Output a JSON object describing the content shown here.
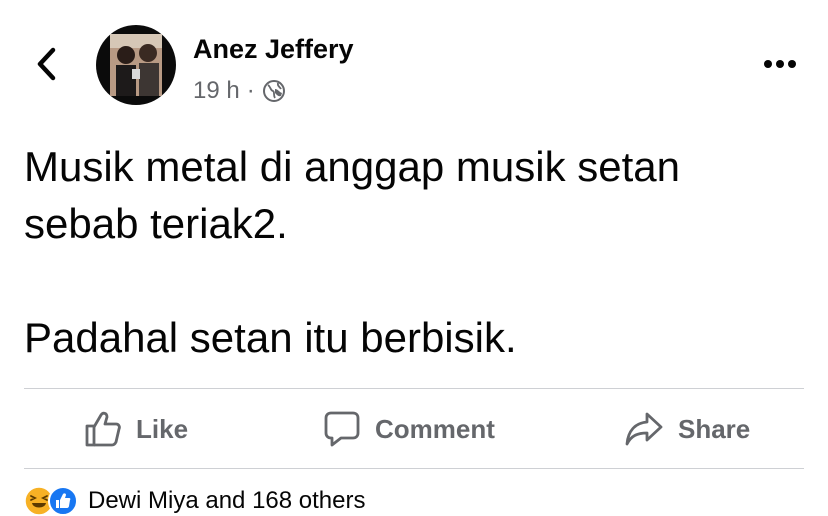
{
  "post": {
    "author_name": "Anez Jeffery",
    "time": "19 h",
    "separator": "·",
    "privacy_icon": "globe-icon",
    "paragraphs": [
      "Musik metal di anggap musik setan sebab teriak2.",
      "Padahal setan itu berbisik."
    ]
  },
  "nav": {
    "back_icon": "chevron-left-icon",
    "more_icon": "more-dots-icon"
  },
  "actions": {
    "like_label": "Like",
    "comment_label": "Comment",
    "share_label": "Share"
  },
  "reactions": {
    "icons": [
      "haha-icon",
      "like-reaction-icon"
    ],
    "text": "Dewi Miya and 168 others"
  },
  "colors": {
    "text": "#050505",
    "secondary": "#65676b",
    "divider": "#ced0d4",
    "like_blue": "#1877f2",
    "haha_yellow": "#f7b125"
  }
}
